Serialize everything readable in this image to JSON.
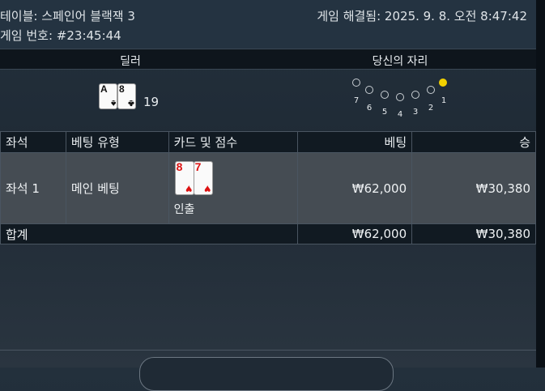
{
  "header": {
    "table_label": "테이블: 스페인어 블랙잭 3",
    "game_id": "게임 번호: #23:45:44",
    "resolved": "게임 해결됨: 2025. 9. 8. 오전 8:47:42"
  },
  "sections": {
    "dealer": "딜러",
    "your_seat": "당신의 자리"
  },
  "dealer": {
    "cards": [
      {
        "rank": "A",
        "suit": "♠"
      },
      {
        "rank": "8",
        "suit": "♣"
      }
    ],
    "score": "19"
  },
  "seats": {
    "numbers": [
      "7",
      "6",
      "5",
      "4",
      "3",
      "2",
      "1"
    ],
    "active": "1"
  },
  "table": {
    "headers": {
      "seat": "좌석",
      "bet_type": "베팅 유형",
      "cards": "카드 및 점수",
      "bet": "베팅",
      "win": "승"
    },
    "rows": [
      {
        "seat": "좌석 1",
        "bet_type": "메인 베팅",
        "cards": [
          {
            "rank": "8",
            "suit": "♥"
          },
          {
            "rank": "7",
            "suit": "♥"
          }
        ],
        "result": "인출",
        "bet": "₩62,000",
        "win": "₩30,380"
      }
    ],
    "total": {
      "label": "합계",
      "bet": "₩62,000",
      "win": "₩30,380"
    }
  },
  "colors": {
    "active_seat": "#f2d100",
    "header_bg": "#243341",
    "row_bg": "#454c53"
  }
}
